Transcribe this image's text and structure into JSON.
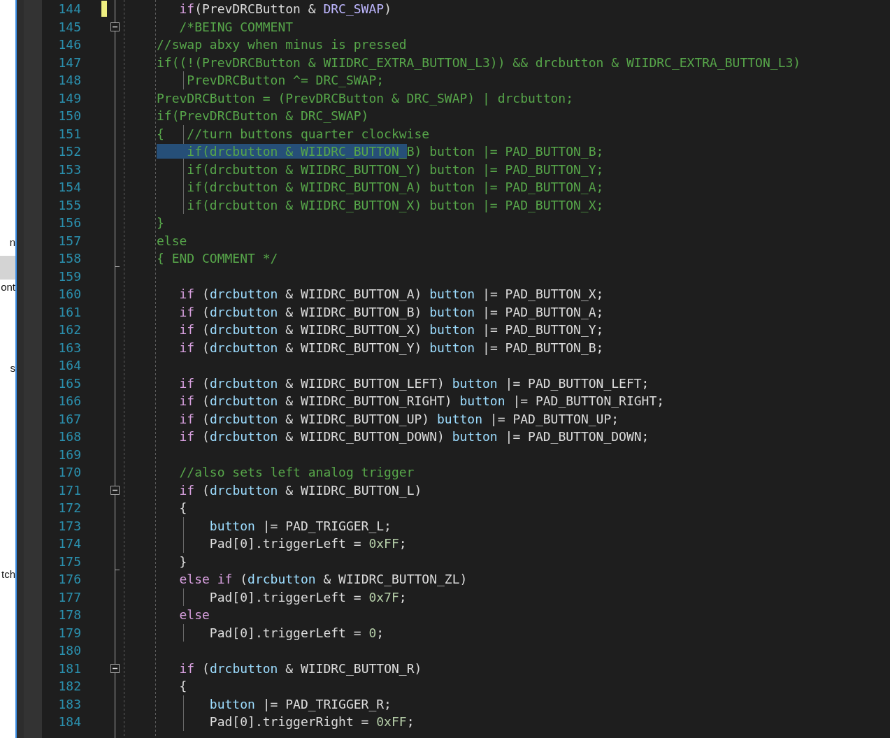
{
  "side_panel": {
    "items": [
      {
        "label": "n",
        "selected": false
      },
      {
        "selected": true
      },
      {
        "label": "ont",
        "selected": false
      },
      {
        "label": "s",
        "selected": false
      },
      {
        "label": "tch",
        "selected": false
      }
    ]
  },
  "editor": {
    "lines": [
      {
        "number": "144",
        "changed": true,
        "tokens": [
          {
            "text": "   if",
            "kind": "keyword"
          },
          {
            "text": "(PrevDRCButton & ",
            "kind": "plain"
          },
          {
            "text": "DRC_SWAP",
            "kind": "macro"
          },
          {
            "text": ")",
            "kind": "plain"
          }
        ]
      },
      {
        "number": "145",
        "collapsible": true,
        "expanded": true,
        "tokens": [
          {
            "text": "   /*BEING COMMENT",
            "kind": "comment"
          }
        ]
      },
      {
        "number": "146",
        "tokens": [
          {
            "text": "//swap abxy when minus is pressed",
            "kind": "comment"
          }
        ]
      },
      {
        "number": "147",
        "tokens": [
          {
            "text": "if((!(PrevDRCButton & WIIDRC_EXTRA_BUTTON_L3)) && drcbutton & WIIDRC_EXTRA_BUTTON_L3)",
            "kind": "comment"
          }
        ]
      },
      {
        "number": "148",
        "tokens": [
          {
            "text": "    PrevDRCButton ^= DRC_SWAP;",
            "kind": "comment"
          }
        ]
      },
      {
        "number": "149",
        "tokens": [
          {
            "text": "PrevDRCButton = (PrevDRCButton & DRC_SWAP) | drcbutton;",
            "kind": "comment"
          }
        ]
      },
      {
        "number": "150",
        "tokens": [
          {
            "text": "if(PrevDRCButton & DRC_SWAP)",
            "kind": "comment"
          }
        ]
      },
      {
        "number": "151",
        "tokens": [
          {
            "text": "{   //turn buttons quarter clockwise",
            "kind": "comment"
          }
        ]
      },
      {
        "number": "152",
        "tokens": [
          {
            "text": "    if(drcbutton & WIIDRC_BUTTON_",
            "kind": "comment",
            "selected": true
          },
          {
            "text": "B) button |= PAD_BUTTON_B;",
            "kind": "comment",
            "selected": false
          }
        ]
      },
      {
        "number": "153",
        "tokens": [
          {
            "text": "    if(drcbutton & WIIDRC_BUTTON_Y) button |= PAD_BUTTON_Y;",
            "kind": "comment"
          }
        ]
      },
      {
        "number": "154",
        "tokens": [
          {
            "text": "    if(drcbutton & WIIDRC_BUTTON_A) button |= PAD_BUTTON_A;",
            "kind": "comment"
          }
        ]
      },
      {
        "number": "155",
        "tokens": [
          {
            "text": "    if(drcbutton & WIIDRC_BUTTON_X) button |= PAD_BUTTON_X;",
            "kind": "comment"
          }
        ]
      },
      {
        "number": "156",
        "tokens": [
          {
            "text": "}",
            "kind": "comment"
          }
        ]
      },
      {
        "number": "157",
        "tokens": [
          {
            "text": "else",
            "kind": "comment"
          }
        ]
      },
      {
        "number": "158",
        "block_end": true,
        "tokens": [
          {
            "text": "{ END COMMENT */",
            "kind": "comment"
          }
        ]
      },
      {
        "number": "159"
      },
      {
        "number": "160",
        "tokens": [
          {
            "text": "   if",
            "kind": "keyword"
          },
          {
            "text": " (",
            "kind": "plain"
          },
          {
            "text": "drcbutton",
            "kind": "variable"
          },
          {
            "text": " & WIIDRC_BUTTON_A) ",
            "kind": "plain"
          },
          {
            "text": "button",
            "kind": "variable"
          },
          {
            "text": " |= PAD_BUTTON_X;",
            "kind": "plain"
          }
        ]
      },
      {
        "number": "161",
        "tokens": [
          {
            "text": "   if",
            "kind": "keyword"
          },
          {
            "text": " (",
            "kind": "plain"
          },
          {
            "text": "drcbutton",
            "kind": "variable"
          },
          {
            "text": " & WIIDRC_BUTTON_B) ",
            "kind": "plain"
          },
          {
            "text": "button",
            "kind": "variable"
          },
          {
            "text": " |= PAD_BUTTON_A;",
            "kind": "plain"
          }
        ]
      },
      {
        "number": "162",
        "tokens": [
          {
            "text": "   if",
            "kind": "keyword"
          },
          {
            "text": " (",
            "kind": "plain"
          },
          {
            "text": "drcbutton",
            "kind": "variable"
          },
          {
            "text": " & WIIDRC_BUTTON_X) ",
            "kind": "plain"
          },
          {
            "text": "button",
            "kind": "variable"
          },
          {
            "text": " |= PAD_BUTTON_Y;",
            "kind": "plain"
          }
        ]
      },
      {
        "number": "163",
        "tokens": [
          {
            "text": "   if",
            "kind": "keyword"
          },
          {
            "text": " (",
            "kind": "plain"
          },
          {
            "text": "drcbutton",
            "kind": "variable"
          },
          {
            "text": " & WIIDRC_BUTTON_Y) ",
            "kind": "plain"
          },
          {
            "text": "button",
            "kind": "variable"
          },
          {
            "text": " |= PAD_BUTTON_B;",
            "kind": "plain"
          }
        ]
      },
      {
        "number": "164"
      },
      {
        "number": "165",
        "tokens": [
          {
            "text": "   if",
            "kind": "keyword"
          },
          {
            "text": " (",
            "kind": "plain"
          },
          {
            "text": "drcbutton",
            "kind": "variable"
          },
          {
            "text": " & WIIDRC_BUTTON_LEFT) ",
            "kind": "plain"
          },
          {
            "text": "button",
            "kind": "variable"
          },
          {
            "text": " |= PAD_BUTTON_LEFT;",
            "kind": "plain"
          }
        ]
      },
      {
        "number": "166",
        "tokens": [
          {
            "text": "   if",
            "kind": "keyword"
          },
          {
            "text": " (",
            "kind": "plain"
          },
          {
            "text": "drcbutton",
            "kind": "variable"
          },
          {
            "text": " & WIIDRC_BUTTON_RIGHT) ",
            "kind": "plain"
          },
          {
            "text": "button",
            "kind": "variable"
          },
          {
            "text": " |= PAD_BUTTON_RIGHT;",
            "kind": "plain"
          }
        ]
      },
      {
        "number": "167",
        "tokens": [
          {
            "text": "   if",
            "kind": "keyword"
          },
          {
            "text": " (",
            "kind": "plain"
          },
          {
            "text": "drcbutton",
            "kind": "variable"
          },
          {
            "text": " & WIIDRC_BUTTON_UP) ",
            "kind": "plain"
          },
          {
            "text": "button",
            "kind": "variable"
          },
          {
            "text": " |= PAD_BUTTON_UP;",
            "kind": "plain"
          }
        ]
      },
      {
        "number": "168",
        "tokens": [
          {
            "text": "   if",
            "kind": "keyword"
          },
          {
            "text": " (",
            "kind": "plain"
          },
          {
            "text": "drcbutton",
            "kind": "variable"
          },
          {
            "text": " & WIIDRC_BUTTON_DOWN) ",
            "kind": "plain"
          },
          {
            "text": "button",
            "kind": "variable"
          },
          {
            "text": " |= PAD_BUTTON_DOWN;",
            "kind": "plain"
          }
        ]
      },
      {
        "number": "169"
      },
      {
        "number": "170",
        "tokens": [
          {
            "text": "   //also sets left analog trigger",
            "kind": "comment"
          }
        ]
      },
      {
        "number": "171",
        "collapsible": true,
        "expanded": true,
        "tokens": [
          {
            "text": "   if",
            "kind": "keyword"
          },
          {
            "text": " (",
            "kind": "plain"
          },
          {
            "text": "drcbutton",
            "kind": "variable"
          },
          {
            "text": " & WIIDRC_BUTTON_L)",
            "kind": "plain"
          }
        ]
      },
      {
        "number": "172",
        "tokens": [
          {
            "text": "   {",
            "kind": "plain"
          }
        ]
      },
      {
        "number": "173",
        "tokens": [
          {
            "text": "       button",
            "kind": "variable"
          },
          {
            "text": " |= PAD_TRIGGER_L;",
            "kind": "plain"
          }
        ]
      },
      {
        "number": "174",
        "tokens": [
          {
            "text": "       Pad[0].triggerLeft = ",
            "kind": "plain"
          },
          {
            "text": "0xFF",
            "kind": "number"
          },
          {
            "text": ";",
            "kind": "plain"
          }
        ]
      },
      {
        "number": "175",
        "block_end": true,
        "tokens": [
          {
            "text": "   }",
            "kind": "plain"
          }
        ]
      },
      {
        "number": "176",
        "tokens": [
          {
            "text": "   else if",
            "kind": "keyword"
          },
          {
            "text": " (",
            "kind": "plain"
          },
          {
            "text": "drcbutton",
            "kind": "variable"
          },
          {
            "text": " & WIIDRC_BUTTON_ZL)",
            "kind": "plain"
          }
        ]
      },
      {
        "number": "177",
        "tokens": [
          {
            "text": "       Pad[0].triggerLeft = ",
            "kind": "plain"
          },
          {
            "text": "0x7F",
            "kind": "number"
          },
          {
            "text": ";",
            "kind": "plain"
          }
        ]
      },
      {
        "number": "178",
        "tokens": [
          {
            "text": "   else",
            "kind": "keyword"
          }
        ]
      },
      {
        "number": "179",
        "tokens": [
          {
            "text": "       Pad[0].triggerLeft = ",
            "kind": "plain"
          },
          {
            "text": "0",
            "kind": "number"
          },
          {
            "text": ";",
            "kind": "plain"
          }
        ]
      },
      {
        "number": "180"
      },
      {
        "number": "181",
        "collapsible": true,
        "expanded": true,
        "tokens": [
          {
            "text": "   if",
            "kind": "keyword"
          },
          {
            "text": " (",
            "kind": "plain"
          },
          {
            "text": "drcbutton",
            "kind": "variable"
          },
          {
            "text": " & WIIDRC_BUTTON_R)",
            "kind": "plain"
          }
        ]
      },
      {
        "number": "182",
        "tokens": [
          {
            "text": "   {",
            "kind": "plain"
          }
        ]
      },
      {
        "number": "183",
        "tokens": [
          {
            "text": "       button",
            "kind": "variable"
          },
          {
            "text": " |= PAD_TRIGGER_R;",
            "kind": "plain"
          }
        ]
      },
      {
        "number": "184",
        "tokens": [
          {
            "text": "       Pad[0].triggerRight = ",
            "kind": "plain"
          },
          {
            "text": "0xFF",
            "kind": "number"
          },
          {
            "text": ";",
            "kind": "plain"
          }
        ]
      }
    ]
  }
}
